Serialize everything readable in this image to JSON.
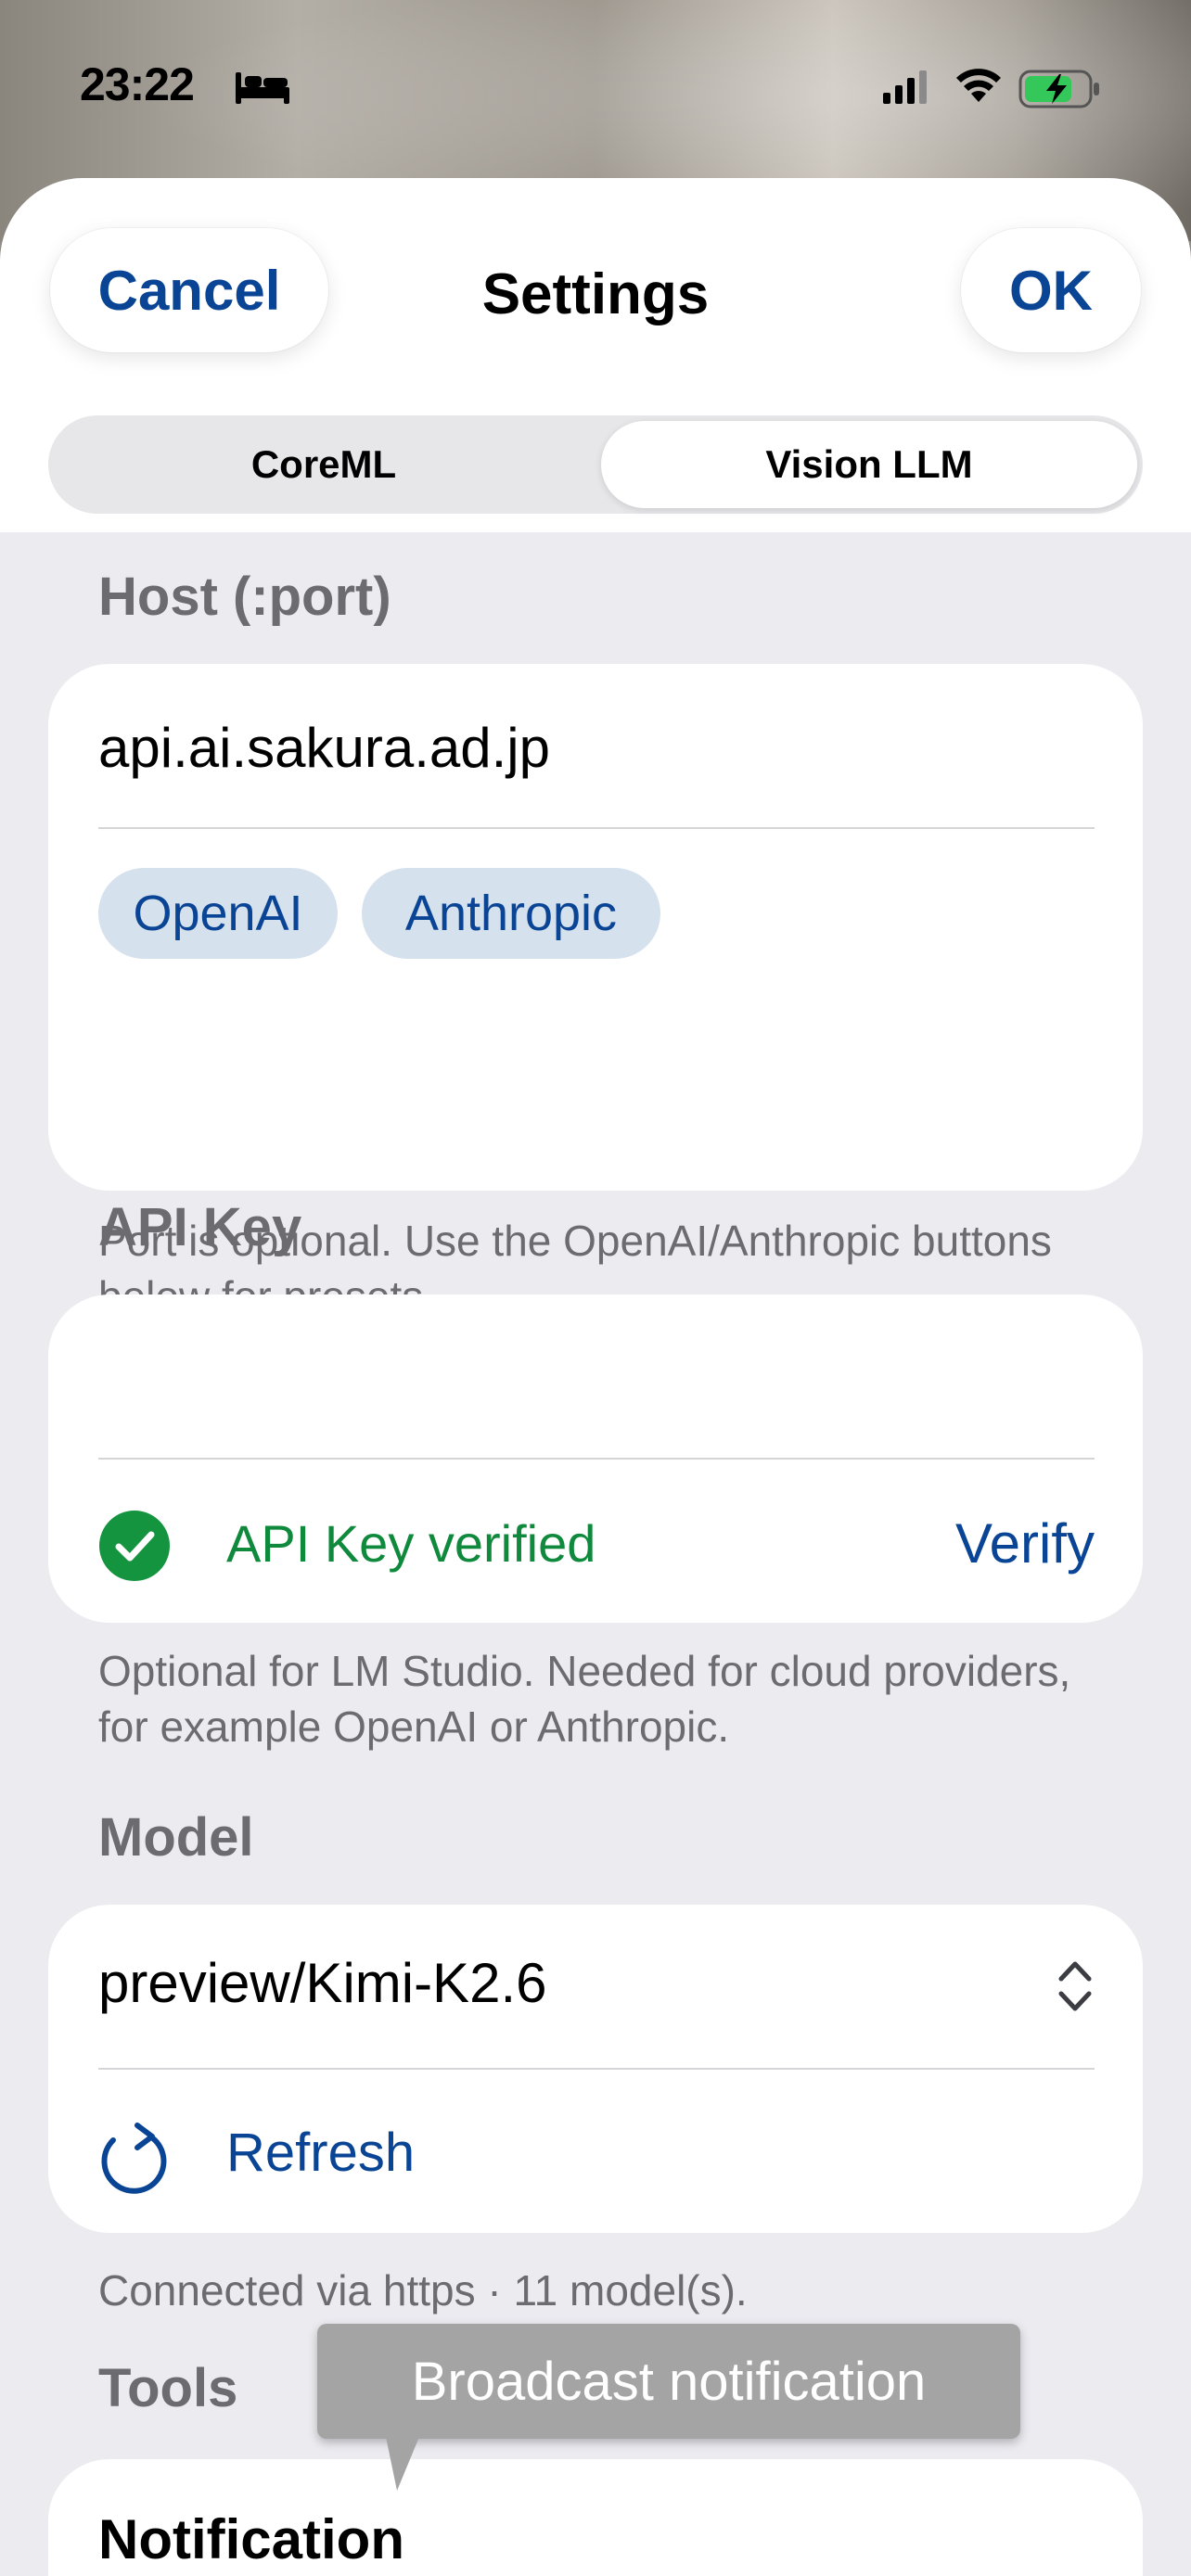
{
  "status_bar": {
    "time": "23:22",
    "icons": [
      "bed-icon",
      "cellular-signal-icon",
      "wifi-icon",
      "battery-charging-icon"
    ]
  },
  "header": {
    "cancel_label": "Cancel",
    "title": "Settings",
    "ok_label": "OK"
  },
  "tabs": [
    {
      "label": "CoreML",
      "selected": false
    },
    {
      "label": "Vision LLM",
      "selected": true
    }
  ],
  "host": {
    "label": "Host (:port)",
    "value": "api.ai.sakura.ad.jp",
    "presets": [
      "OpenAI",
      "Anthropic"
    ],
    "footnote": "Port is optional. Use the OpenAI/Anthropic buttons below for presets."
  },
  "api_key": {
    "label": "API Key",
    "value": "",
    "status_text": "API Key verified",
    "verify_label": "Verify",
    "footnote": "Optional for LM Studio. Needed for cloud providers, for example OpenAI or Anthropic."
  },
  "model": {
    "label": "Model",
    "selected": "preview/Kimi-K2.6",
    "refresh_label": "Refresh",
    "footnote": "Connected via https · 11 model(s)."
  },
  "tools": {
    "label": "Tools",
    "first_item": "Notification"
  },
  "tooltip": {
    "text": "Broadcast notification"
  },
  "colors": {
    "accent": "#0a4595",
    "success": "#0f8a3c",
    "sheet_background": "#ebebf0",
    "chip_background": "#d6e1ee"
  }
}
